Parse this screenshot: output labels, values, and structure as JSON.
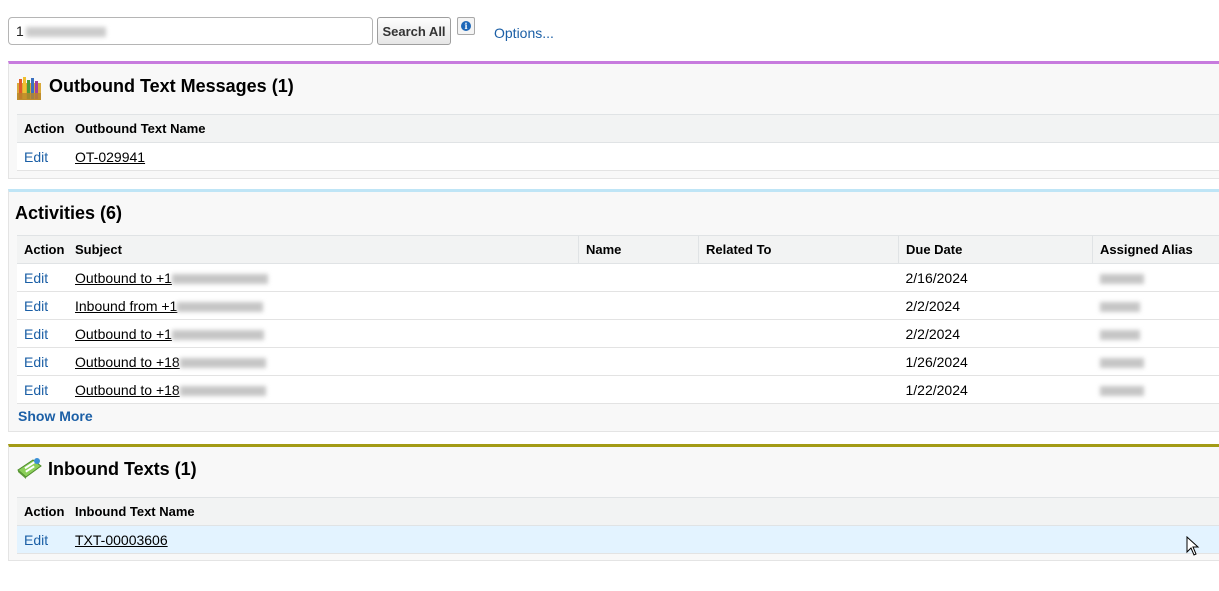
{
  "search": {
    "value_prefix": "1",
    "button_label": "Search All",
    "options_label": "Options..."
  },
  "outbound": {
    "title": "Outbound Text Messages (1)",
    "accent": "#c77bde",
    "icon": "outbound-text-icon",
    "columns": [
      "Action",
      "Outbound Text Name"
    ],
    "rows": [
      {
        "action": "Edit",
        "name": "OT-029941"
      }
    ]
  },
  "activities": {
    "title": "Activities (6)",
    "accent": "#bfe5f6",
    "columns": [
      "Action",
      "Subject",
      "Name",
      "Related To",
      "Due Date",
      "Assigned Alias"
    ],
    "rows": [
      {
        "action": "Edit",
        "subject": "Outbound to +1",
        "due": "2/16/2024"
      },
      {
        "action": "Edit",
        "subject": "Inbound from +1",
        "due": "2/2/2024"
      },
      {
        "action": "Edit",
        "subject": "Outbound to +1",
        "due": "2/2/2024"
      },
      {
        "action": "Edit",
        "subject": "Outbound to +18",
        "due": "1/26/2024"
      },
      {
        "action": "Edit",
        "subject": "Outbound to +18",
        "due": "1/22/2024"
      }
    ],
    "show_more": "Show More"
  },
  "inbound": {
    "title": "Inbound Texts (1)",
    "accent": "#a39b15",
    "icon": "inbound-text-icon",
    "columns": [
      "Action",
      "Inbound Text Name"
    ],
    "rows": [
      {
        "action": "Edit",
        "name": "TXT-00003606"
      }
    ]
  }
}
